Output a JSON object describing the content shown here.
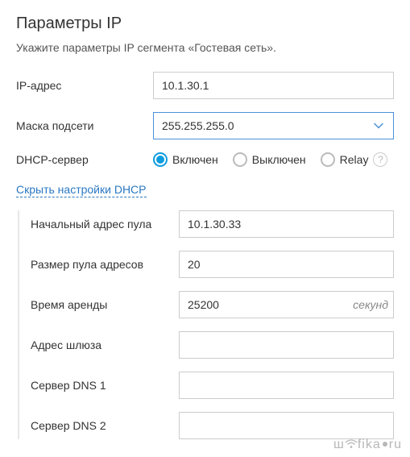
{
  "title": "Параметры IP",
  "subtitle": "Укажите параметры IP сегмента «Гостевая сеть».",
  "fields": {
    "ip_label": "IP-адрес",
    "ip_value": "10.1.30.1",
    "mask_label": "Маска подсети",
    "mask_value": "255.255.255.0",
    "dhcp_label": "DHCP-сервер"
  },
  "dhcp_modes": {
    "on": "Включен",
    "off": "Выключен",
    "relay": "Relay",
    "selected": "on"
  },
  "toggle_link": "Скрыть настройки DHCP",
  "dhcp": {
    "pool_start_label": "Начальный адрес пула",
    "pool_start_value": "10.1.30.33",
    "pool_size_label": "Размер пула адресов",
    "pool_size_value": "20",
    "lease_label": "Время аренды",
    "lease_value": "25200",
    "lease_unit": "секунд",
    "gateway_label": "Адрес шлюза",
    "gateway_value": "",
    "dns1_label": "Сервер DNS 1",
    "dns1_value": "",
    "dns2_label": "Сервер DNS 2",
    "dns2_value": ""
  },
  "watermark": "wifika.ru"
}
